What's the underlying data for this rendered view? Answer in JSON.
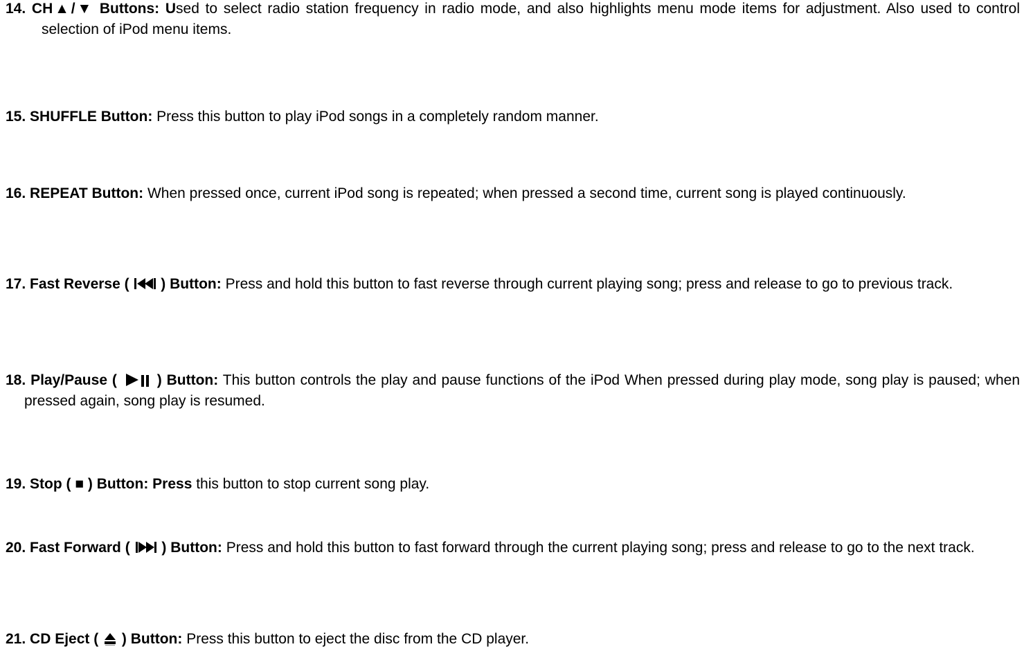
{
  "items": [
    {
      "lead": "14. CH▲/▼ Buttons: U",
      "text": "sed to select radio station frequency in radio mode, and also highlights menu   mode     items     for adjustment. Also used to control selection of iPod menu items."
    },
    {
      "lead": "15. SHUFFLE Button:",
      "text": " Press this button to play iPod songs in a completely random manner."
    },
    {
      "lead": "16. REPEAT Button:",
      "text": " When pressed once, current iPod song is repeated; when pressed a second time, current song is played continuously."
    },
    {
      "lead": "17. Fast Reverse (",
      "icon": "fast-reverse-icon",
      "lead2": ") Button:",
      "text": " Press and hold this button to fast reverse through current playing song; press and release to go to previous track."
    },
    {
      "lead": "18. Play/Pause (",
      "icon": "play-pause-icon",
      "lead2": ") Button:",
      "text": " This button controls the play and pause functions of the iPod When pressed during play mode, song play is paused; when pressed again, song play is resumed."
    },
    {
      "lead": "19. Stop ( ■ ) Button: Press",
      "text": " this button to stop current song play."
    },
    {
      "lead": "20. Fast Forward (",
      "icon": "fast-forward-icon",
      "lead2": ") Button:",
      "text": " Press and hold this button to fast forward through the current playing song; press and release to go to the next track."
    },
    {
      "lead": "21. CD Eject (",
      "icon": "eject-icon",
      "lead2": ") Button:",
      "text": " Press this button to eject the disc from the CD player."
    }
  ]
}
